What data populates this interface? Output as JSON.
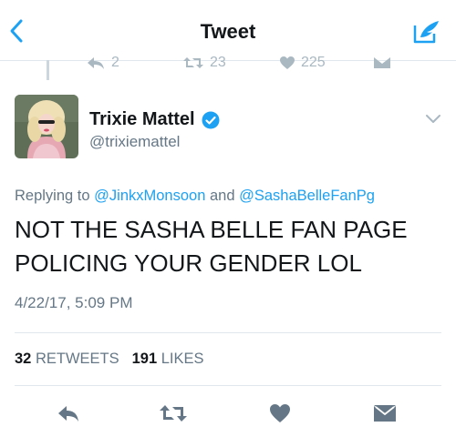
{
  "nav": {
    "title": "Tweet"
  },
  "previous_tweet": {
    "reply_count": "2",
    "retweet_count": "23",
    "like_count": "225"
  },
  "tweet": {
    "author_name": "Trixie Mattel",
    "author_handle": "@trixiemattel",
    "replying_prefix": "Replying to",
    "mention_1": "@JinkxMonsoon",
    "and_word": "and",
    "mention_2": "@SashaBelleFanPg",
    "text_line_1": "NOT THE SASHA BELLE FAN PAGE",
    "text_line_2": "POLICING YOUR GENDER LOL",
    "timestamp": "4/22/17, 5:09 PM",
    "retweet_count": "32",
    "retweets_label": "RETWEETS",
    "like_count": "191",
    "likes_label": "LIKES"
  },
  "colors": {
    "accent": "#1da1f2",
    "secondary_text": "#657786",
    "icon_gray": "#657786",
    "divider": "#e1e8ed"
  },
  "icons": [
    "back-icon",
    "compose-icon",
    "reply-icon",
    "retweet-icon",
    "like-icon",
    "direct-message-icon",
    "verified-icon",
    "chevron-down-icon"
  ]
}
